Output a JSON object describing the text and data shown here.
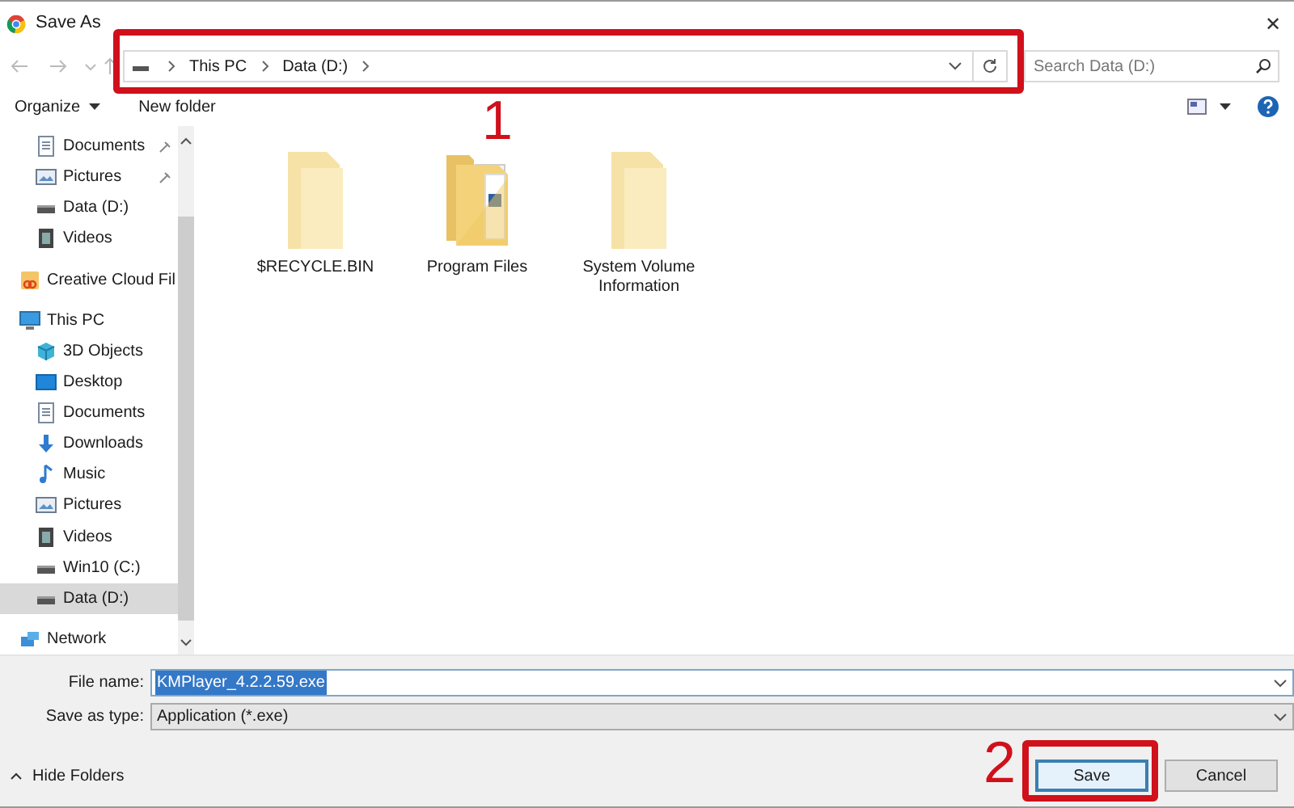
{
  "window": {
    "title": "Save As",
    "close": "✕"
  },
  "address_bar": {
    "path": [
      "This PC",
      "Data (D:)"
    ]
  },
  "search": {
    "placeholder": "Search Data (D:)"
  },
  "toolbar": {
    "organize": "Organize",
    "new_folder": "New folder"
  },
  "sidebar": {
    "quick_access": [
      {
        "label": "Documents",
        "kind": "document",
        "pinned": true,
        "selected": false
      },
      {
        "label": "Pictures",
        "kind": "pictures",
        "pinned": true,
        "selected": false
      },
      {
        "label": "Data (D:)",
        "kind": "drive",
        "pinned": false,
        "selected": false
      },
      {
        "label": "Videos",
        "kind": "video",
        "pinned": false,
        "selected": false
      }
    ],
    "items": [
      {
        "label": "Creative Cloud Fil",
        "kind": "cloud",
        "selected": false
      },
      {
        "label": "This PC",
        "kind": "pc",
        "selected": false,
        "children": [
          {
            "label": "3D Objects",
            "kind": "cube",
            "selected": false
          },
          {
            "label": "Desktop",
            "kind": "desktop",
            "selected": false
          },
          {
            "label": "Documents",
            "kind": "document",
            "selected": false
          },
          {
            "label": "Downloads",
            "kind": "download",
            "selected": false
          },
          {
            "label": "Music",
            "kind": "music",
            "selected": false
          },
          {
            "label": "Pictures",
            "kind": "pictures",
            "selected": false
          },
          {
            "label": "Videos",
            "kind": "video",
            "selected": false
          },
          {
            "label": "Win10 (C:)",
            "kind": "drive",
            "selected": false
          },
          {
            "label": "Data (D:)",
            "kind": "drive",
            "selected": true
          }
        ]
      },
      {
        "label": "Network",
        "kind": "network",
        "selected": false
      }
    ]
  },
  "folders": [
    {
      "name": "$RECYCLE.BIN",
      "kind": "plain"
    },
    {
      "name": "Program Files",
      "kind": "filled"
    },
    {
      "name": "System Volume Information",
      "kind": "plain"
    }
  ],
  "form": {
    "file_name_label": "File name:",
    "file_name": "KMPlayer_4.2.2.59.exe",
    "type_label": "Save as type:",
    "type": "Application (*.exe)"
  },
  "footer": {
    "hide_folders": "Hide Folders",
    "buttons": [
      {
        "label": "Save",
        "default": true
      },
      {
        "label": "Cancel",
        "default": false
      }
    ]
  },
  "annotations": [
    {
      "label": "1"
    },
    {
      "label": "2"
    }
  ]
}
